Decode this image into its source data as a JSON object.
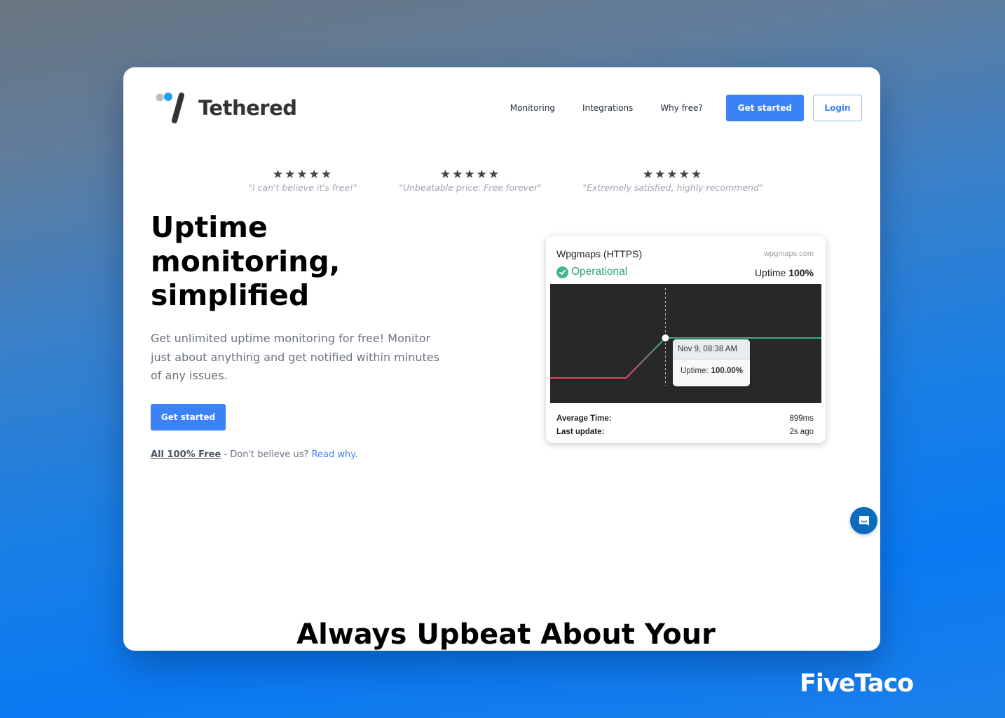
{
  "brand": {
    "name": "Tethered",
    "accent": "#3b82f6",
    "logo_dot_gray": "#bdbdbd",
    "logo_dot_blue": "#1da1f2"
  },
  "nav": {
    "links": [
      {
        "label": "Monitoring"
      },
      {
        "label": "Integrations"
      },
      {
        "label": "Why free?"
      }
    ],
    "get_started_label": "Get started",
    "login_label": "Login"
  },
  "reviews": [
    {
      "rating": 5,
      "stars": "★★★★★",
      "quote": "\"I can't believe it's free!\""
    },
    {
      "rating": 5,
      "stars": "★★★★★",
      "quote": "\"Unbeatable price: Free forever\""
    },
    {
      "rating": 5,
      "stars": "★★★★★",
      "quote": "\"Extremely satisfied, highly recommend\""
    }
  ],
  "hero": {
    "headline_lines": [
      "Uptime",
      "monitoring,",
      "simplified"
    ],
    "subtext": "Get unlimited uptime monitoring for free! Monitor just about anything and get notified within minutes of any issues.",
    "cta_label": "Get started",
    "free_strong": "All 100% Free",
    "free_text": " - Don't believe us? ",
    "free_link": "Read why",
    "free_end": "."
  },
  "monitor_card": {
    "title": "Wpgmaps (HTTPS)",
    "domain": "wpgmaps.com",
    "status": "Operational",
    "uptime_label": "Uptime",
    "uptime_value": "100%",
    "status_color": "#2aa57a",
    "chart": {
      "down_color": "#e0475b",
      "up_color": "#2db37f",
      "points": [
        {
          "x": 0,
          "value": 0
        },
        {
          "x": 0.28,
          "value": 0
        },
        {
          "x": 0.425,
          "value": 1
        },
        {
          "x": 1,
          "value": 1
        }
      ],
      "hover_index": 2,
      "tooltip": {
        "time": "Nov 9, 08:38 AM",
        "label": "Uptime:",
        "value": "100.00%"
      }
    },
    "stats": [
      {
        "label": "Average Time:",
        "value": "899ms"
      },
      {
        "label": "Last update:",
        "value": "2s ago"
      }
    ]
  },
  "section": {
    "title": "Always Upbeat About Your"
  },
  "chat_widget": {
    "icon": "chat-bubble-icon"
  },
  "watermark": "FiveTaco"
}
